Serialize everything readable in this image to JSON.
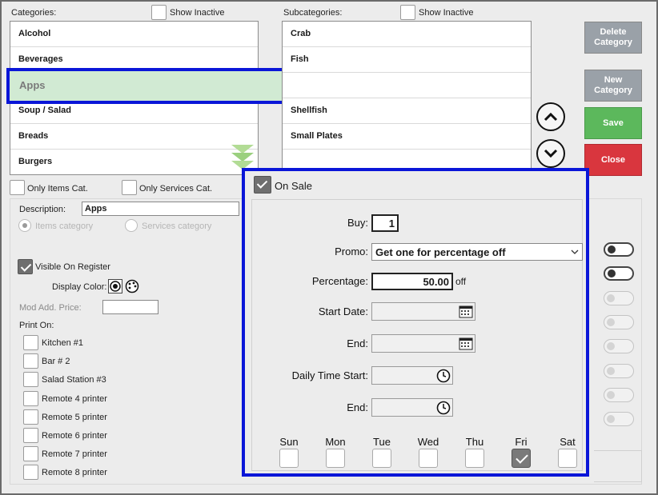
{
  "categories": {
    "header": "Categories:",
    "show_inactive": "Show Inactive",
    "items": [
      "Alcohol",
      "Beverages",
      "Apps",
      "Soup / Salad",
      "Breads",
      "Burgers"
    ],
    "selected": "Apps"
  },
  "subcategories": {
    "header": "Subcategories:",
    "show_inactive": "Show Inactive",
    "items": [
      "Crab",
      "Fish",
      "",
      "Shellfish",
      "Small Plates"
    ]
  },
  "buttons": {
    "delete": "Delete Category",
    "new": "New Category",
    "save": "Save",
    "close": "Close"
  },
  "colors": {
    "save": "#5cb85c",
    "close": "#d9363e",
    "disabled_button": "#9aa1a8",
    "highlight_border": "#0a16d8",
    "selected_row": "#d1ead3",
    "scroll_arrows": "#9bd07f"
  },
  "filters": {
    "only_items": "Only Items Cat.",
    "only_services": "Only Services Cat."
  },
  "details": {
    "description_label": "Description:",
    "description_value": "Apps",
    "items_category": "Items category",
    "services_category": "Services category",
    "visible_on_register": "Visible On Register",
    "display_color": "Display Color:",
    "mod_add_price": "Mod Add. Price:",
    "print_on": "Print On:",
    "printers": [
      "Kitchen #1",
      "Bar # 2",
      "Salad Station #3",
      "Remote 4 printer",
      "Remote 5 printer",
      "Remote 6 printer",
      "Remote 7 printer",
      "Remote 8 printer"
    ]
  },
  "sale": {
    "title": "On Sale",
    "buy_label": "Buy:",
    "buy_value": "1",
    "promo_label": "Promo:",
    "promo_value": "Get one for percentage off",
    "percentage_label": "Percentage:",
    "percentage_value": "50.00",
    "percentage_suffix": "off",
    "start_date_label": "Start Date:",
    "end_label": "End:",
    "daily_time_start_label": "Daily Time Start:",
    "time_end_label": "End:",
    "days": [
      "Sun",
      "Mon",
      "Tue",
      "Wed",
      "Thu",
      "Fri",
      "Sat"
    ],
    "days_checked": [
      "Fri"
    ]
  }
}
